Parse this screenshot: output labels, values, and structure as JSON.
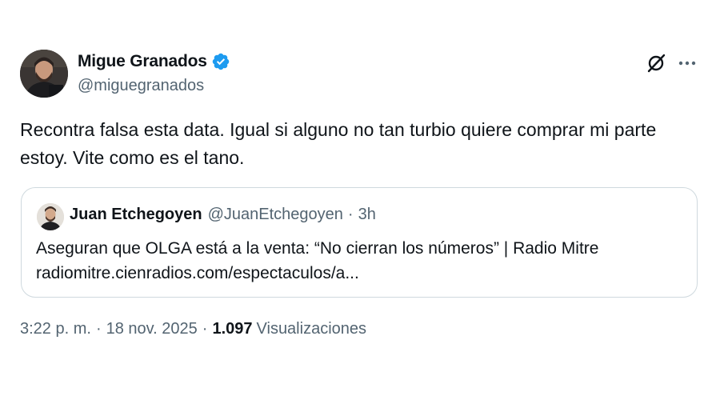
{
  "author": {
    "name": "Migue Granados",
    "handle": "@miguegranados",
    "verified": true,
    "verified_color": "#1d9bf0"
  },
  "icons": {
    "grok": "grok-icon",
    "more": "more-icon",
    "verified": "verified-badge-icon"
  },
  "tweet": {
    "text": "Recontra falsa esta data. Igual si alguno no tan turbio quiere comprar mi parte estoy. Vite como es el tano."
  },
  "quote": {
    "name": "Juan Etchegoyen",
    "handle": "@JuanEtchegoyen",
    "dot": "·",
    "time": "3h",
    "text": "Aseguran que OLGA está a la venta: “No cierran los números” | Radio Mitre",
    "link": "radiomitre.cienradios.com/espectaculos/a..."
  },
  "meta": {
    "time": "3:22 p. m.",
    "sep": "·",
    "date": "18 nov. 2025",
    "sep2": "·",
    "views_count": "1.097",
    "views_label": "Visualizaciones"
  }
}
